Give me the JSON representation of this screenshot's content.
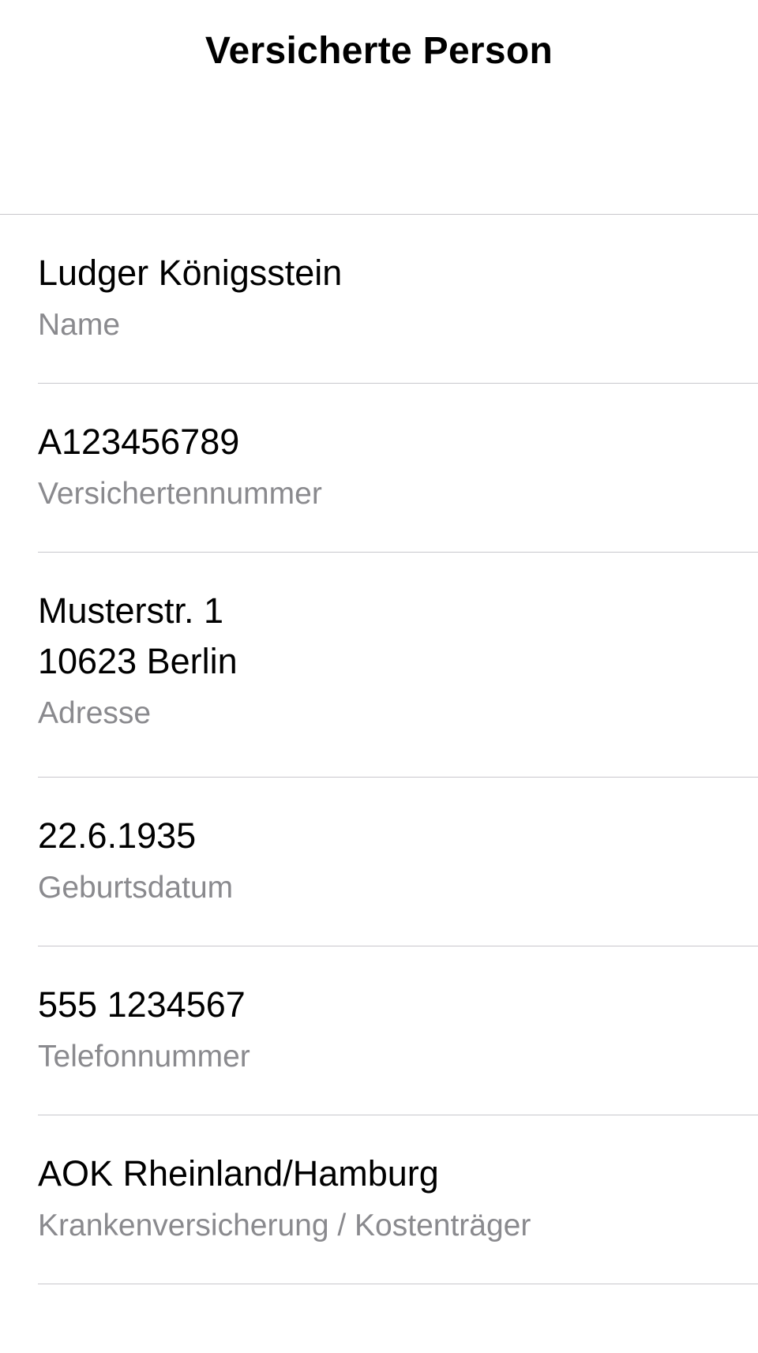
{
  "header": {
    "title": "Versicherte Person"
  },
  "rows": [
    {
      "value": "Ludger Königsstein",
      "label": "Name"
    },
    {
      "value": "A123456789",
      "label": "Versichertennummer"
    },
    {
      "value_line1": "Musterstr. 1",
      "value_line2": "10623 Berlin",
      "label": "Adresse"
    },
    {
      "value": "22.6.1935",
      "label": "Geburtsdatum"
    },
    {
      "value": "555 1234567",
      "label": "Telefonnummer"
    },
    {
      "value": "AOK Rheinland/Hamburg",
      "label": "Krankenversicherung / Kostenträger"
    }
  ]
}
